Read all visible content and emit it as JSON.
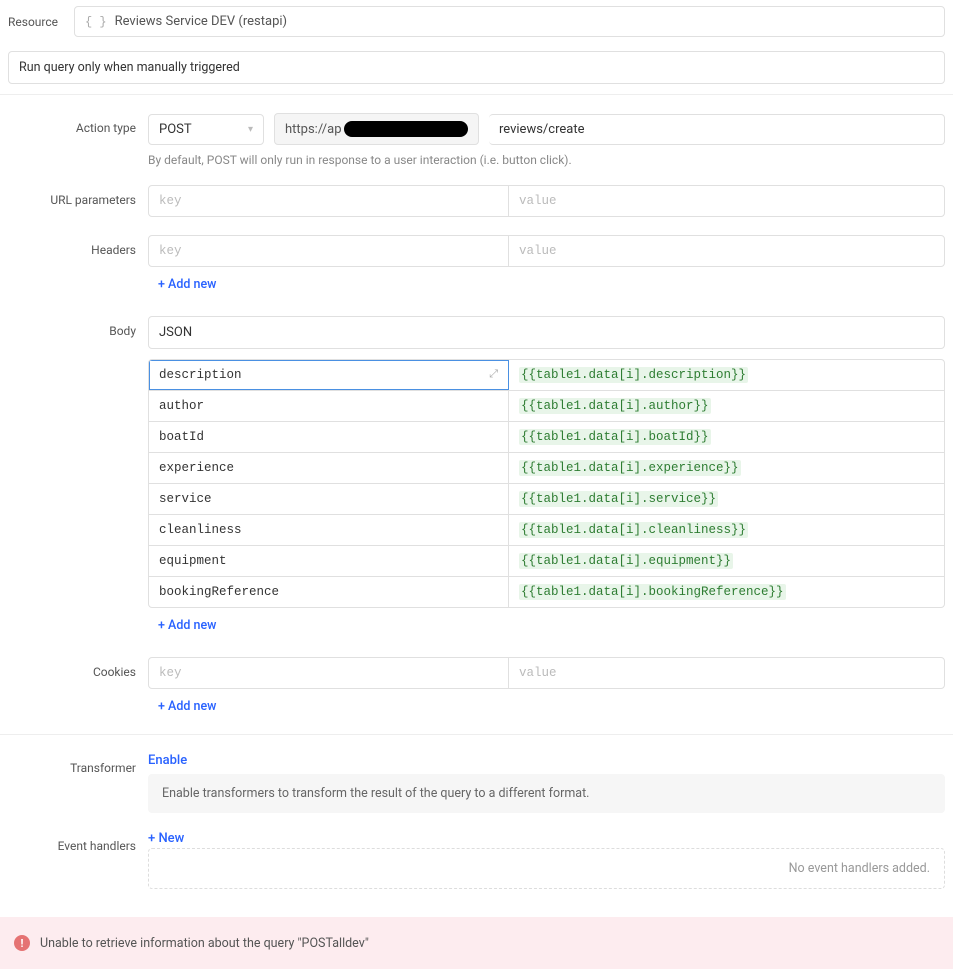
{
  "resource": {
    "label": "Resource",
    "value": "Reviews Service DEV (restapi)"
  },
  "trigger": {
    "text": "Run query only when manually triggered"
  },
  "action": {
    "label": "Action type",
    "method": "POST",
    "base_url_prefix": "https://ap",
    "path": "reviews/create",
    "hint": "By default, POST will only run in response to a user interaction (i.e. button click)."
  },
  "url_params": {
    "label": "URL parameters",
    "rows": [],
    "key_placeholder": "key",
    "value_placeholder": "value"
  },
  "headers": {
    "label": "Headers",
    "rows": [],
    "key_placeholder": "key",
    "value_placeholder": "value",
    "add_new": "+ Add new"
  },
  "body": {
    "label": "Body",
    "type": "JSON",
    "rows": [
      {
        "key": "description",
        "value": "{{table1.data[i].description}}",
        "selected": true
      },
      {
        "key": "author",
        "value": "{{table1.data[i].author}}"
      },
      {
        "key": "boatId",
        "value": "{{table1.data[i].boatId}}"
      },
      {
        "key": "experience",
        "value": "{{table1.data[i].experience}}"
      },
      {
        "key": "service",
        "value": "{{table1.data[i].service}}"
      },
      {
        "key": "cleanliness",
        "value": "{{table1.data[i].cleanliness}}"
      },
      {
        "key": "equipment",
        "value": "{{table1.data[i].equipment}}"
      },
      {
        "key": "bookingReference",
        "value": "{{table1.data[i].bookingReference}}"
      }
    ],
    "add_new": "+ Add new"
  },
  "cookies": {
    "label": "Cookies",
    "rows": [],
    "key_placeholder": "key",
    "value_placeholder": "value",
    "add_new": "+ Add new"
  },
  "transformer": {
    "label": "Transformer",
    "enable": "Enable",
    "info": "Enable transformers to transform the result of the query to a different format."
  },
  "event_handlers": {
    "label": "Event handlers",
    "new_label": "+ New",
    "empty": "No event handlers added."
  },
  "error": {
    "message": "Unable to retrieve information about the query \"POSTalldev\""
  }
}
